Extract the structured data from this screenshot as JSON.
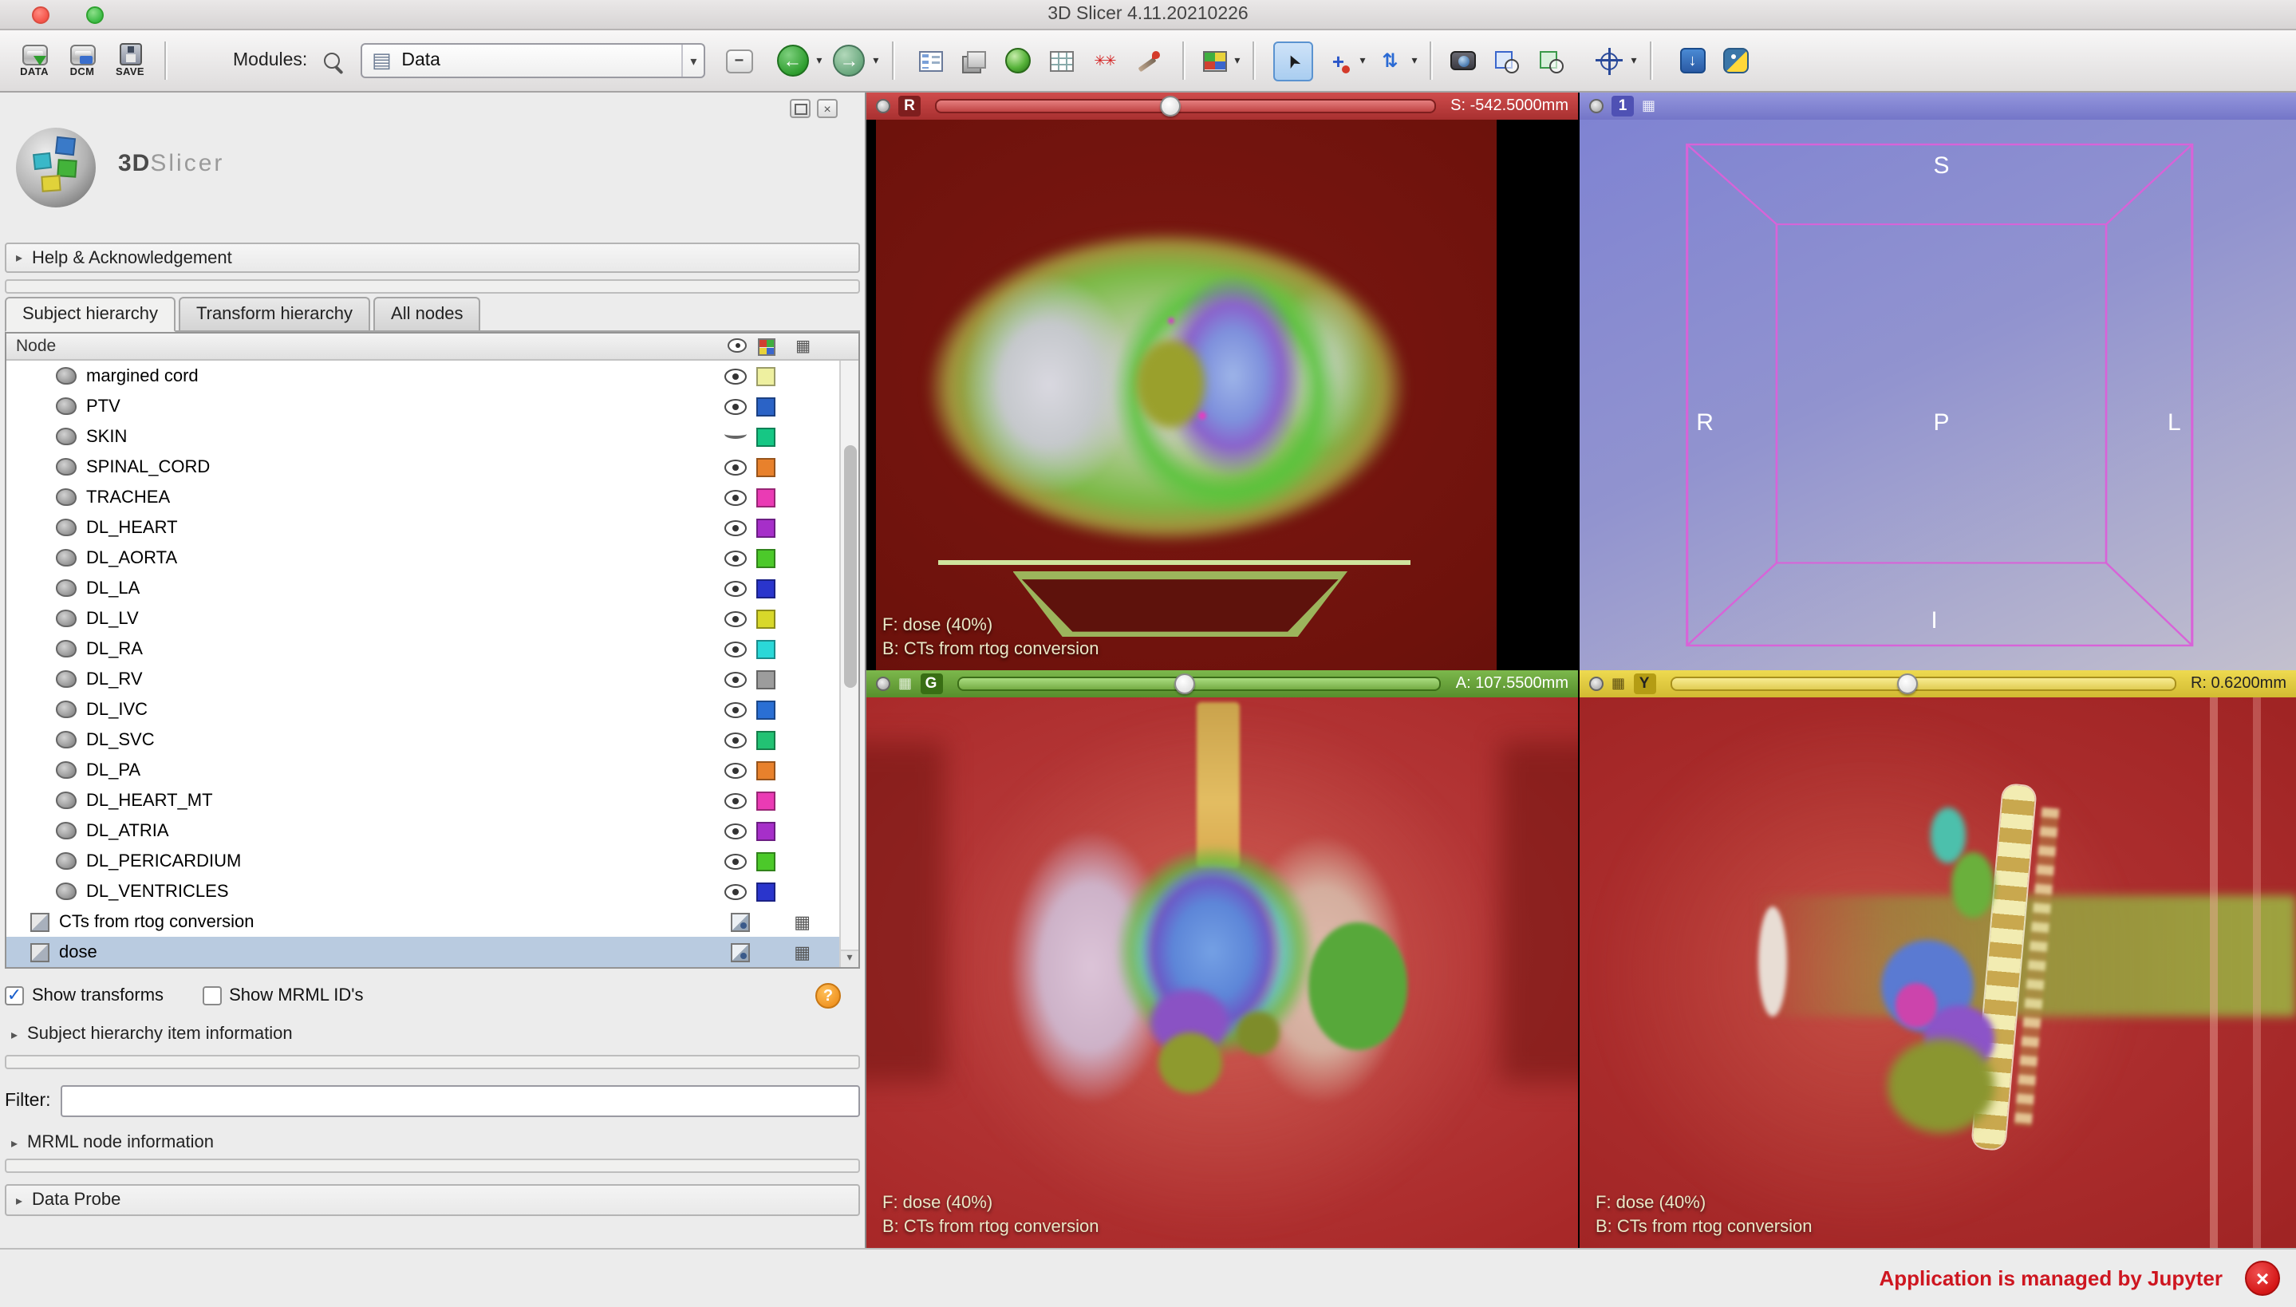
{
  "icons": {
    "chevron_down": "▾",
    "triangle_right": "▸",
    "grid": "▦",
    "check": "✓",
    "close_x": "×",
    "question": "?",
    "minus": "−",
    "back_arrow": "←",
    "forward_arrow": "→",
    "up_down_arrows": "⇅",
    "asterisks": "✳✳",
    "cursor": "➤",
    "module_tree": "▤",
    "down_arrow": "↓"
  },
  "window": {
    "title": "3D Slicer 4.11.20210226"
  },
  "toolbar": {
    "items": [
      {
        "kind": "big",
        "name": "load-data-button",
        "icon": "drive-data-icon",
        "label": "DATA"
      },
      {
        "kind": "big",
        "name": "load-dicom-button",
        "icon": "drive-dicom-icon",
        "label": "DCM"
      },
      {
        "kind": "big",
        "name": "save-scene-button",
        "icon": "floppy-icon",
        "label": "SAVE"
      },
      {
        "kind": "sep"
      },
      {
        "kind": "label",
        "name": "modules-label",
        "text": "Modules:"
      },
      {
        "kind": "icon",
        "name": "module-finder-button",
        "icon": "search-icon"
      },
      {
        "kind": "combo",
        "name": "module-selector-combo",
        "icon": "module-tree-icon",
        "glyph_key": "module_tree",
        "value": "Data"
      },
      {
        "kind": "mini",
        "name": "collapse-toolbar-button",
        "icon": "minus-icon",
        "glyph_key": "minus"
      },
      {
        "kind": "icon",
        "name": "module-history-back-button",
        "icon": "back-arrow-icon",
        "glyph_key": "back_arrow",
        "caret": true
      },
      {
        "kind": "icon",
        "name": "module-history-forward-button",
        "icon": "forward-arrow-icon",
        "glyph_key": "forward_arrow",
        "caret": true
      },
      {
        "kind": "sep"
      },
      {
        "kind": "icon",
        "name": "subject-hierarchy-module-button",
        "icon": "list-table-icon"
      },
      {
        "kind": "icon",
        "name": "volumes-module-button",
        "icon": "cube-icon"
      },
      {
        "kind": "icon",
        "name": "models-module-button",
        "icon": "green-sphere-icon"
      },
      {
        "kind": "icon",
        "name": "tables-module-button",
        "icon": "table-grid-icon"
      },
      {
        "kind": "icon",
        "name": "annotations-module-button",
        "icon": "red-asterisk-icon",
        "glyph_key": "asterisks"
      },
      {
        "kind": "icon",
        "name": "segment-editor-module-button",
        "icon": "paint-wand-icon"
      },
      {
        "kind": "sep"
      },
      {
        "kind": "icon",
        "name": "layout-selector-button",
        "icon": "layout-grid-icon",
        "caret": true
      },
      {
        "kind": "sep"
      },
      {
        "kind": "icon",
        "name": "mouse-interaction-button",
        "icon": "cursor-icon",
        "glyph_key": "cursor",
        "selected": true
      },
      {
        "kind": "icon",
        "name": "place-markup-button",
        "icon": "place-point-icon",
        "caret": true
      },
      {
        "kind": "icon",
        "name": "module-shortcuts-button",
        "icon": "blue-arrows-icon",
        "glyph_key": "up_down_arrows",
        "caret": true
      },
      {
        "kind": "sep"
      },
      {
        "kind": "icon",
        "name": "screenshot-button",
        "icon": "screenshot-icon"
      },
      {
        "kind": "icon",
        "name": "scene-view-save-button",
        "icon": "magnifier-box-icon"
      },
      {
        "kind": "icon",
        "name": "scene-view-restore-button",
        "icon": "magnifier-box2-icon"
      },
      {
        "kind": "icon",
        "name": "crosshair-button",
        "icon": "crosshair-icon",
        "caret": true
      },
      {
        "kind": "sep"
      },
      {
        "kind": "icon",
        "name": "extensions-manager-button",
        "icon": "extensions-icon",
        "glyph_key": "down_arrow"
      },
      {
        "kind": "icon",
        "name": "python-console-button",
        "icon": "python-icon"
      }
    ]
  },
  "panel": {
    "logo_bold": "3D",
    "logo_rest": "Slicer",
    "help_section_label": "Help & Acknowledgement",
    "tabs": [
      {
        "label": "Subject hierarchy",
        "active": true
      },
      {
        "label": "Transform hierarchy",
        "active": false
      },
      {
        "label": "All nodes",
        "active": false
      }
    ],
    "tree": {
      "header": "Node",
      "items": [
        {
          "name": "margined cord",
          "type": "segment",
          "color": "#eef0a0",
          "visible": true
        },
        {
          "name": "PTV",
          "type": "segment",
          "color": "#2b63c6",
          "visible": true
        },
        {
          "name": "SKIN",
          "type": "segment",
          "color": "#16c784",
          "visible": false
        },
        {
          "name": "SPINAL_CORD",
          "type": "segment",
          "color": "#e8812c",
          "visible": true
        },
        {
          "name": "TRACHEA",
          "type": "segment",
          "color": "#ea3bb4",
          "visible": true
        },
        {
          "name": "DL_HEART",
          "type": "segment",
          "color": "#a62fc9",
          "visible": true
        },
        {
          "name": "DL_AORTA",
          "type": "segment",
          "color": "#4cc92a",
          "visible": true
        },
        {
          "name": "DL_LA",
          "type": "segment",
          "color": "#2a35cc",
          "visible": true
        },
        {
          "name": "DL_LV",
          "type": "segment",
          "color": "#d8d82a",
          "visible": true
        },
        {
          "name": "DL_RA",
          "type": "segment",
          "color": "#2ad8d8",
          "visible": true
        },
        {
          "name": "DL_RV",
          "type": "segment",
          "color": "#9c9c9c",
          "visible": true
        },
        {
          "name": "DL_IVC",
          "type": "segment",
          "color": "#2a6fd4",
          "visible": true
        },
        {
          "name": "DL_SVC",
          "type": "segment",
          "color": "#22c273",
          "visible": true
        },
        {
          "name": "DL_PA",
          "type": "segment",
          "color": "#e8812c",
          "visible": true
        },
        {
          "name": "DL_HEART_MT",
          "type": "segment",
          "color": "#ea3bb4",
          "visible": true
        },
        {
          "name": "DL_ATRIA",
          "type": "segment",
          "color": "#a62fc9",
          "visible": true
        },
        {
          "name": "DL_PERICARDIUM",
          "type": "segment",
          "color": "#4cc92a",
          "visible": true
        },
        {
          "name": "DL_VENTRICLES",
          "type": "segment",
          "color": "#2a35cc",
          "visible": true
        },
        {
          "name": "CTs from rtog conversion",
          "type": "volume",
          "selected": false
        },
        {
          "name": "dose",
          "type": "volume",
          "selected": true
        }
      ]
    },
    "show_transforms_label": "Show transforms",
    "show_transforms_checked": true,
    "show_mrml_label": "Show MRML ID's",
    "show_mrml_checked": false,
    "item_info_label": "Subject hierarchy item information",
    "filter_label": "Filter:",
    "filter_value": "",
    "mrml_info_label": "MRML node information",
    "data_probe_label": "Data Probe"
  },
  "views": {
    "red": {
      "label": "R",
      "coord": "S: -542.5000mm",
      "slider_pos": 0.47,
      "fg": "F: dose (40%)",
      "bg": "B: CTs from rtog conversion",
      "color": "#cc4a4a"
    },
    "threeD": {
      "label": "1",
      "letters": [
        "S",
        "R",
        "P",
        "L",
        "I"
      ],
      "color": "#8a8cd8"
    },
    "green": {
      "label": "G",
      "coord": "A: 107.5500mm",
      "slider_pos": 0.47,
      "fg": "F: dose (40%)",
      "bg": "B: CTs from rtog conversion",
      "color": "#6aa83a"
    },
    "yellow": {
      "label": "Y",
      "coord": "R: 0.6200mm",
      "slider_pos": 0.47,
      "fg": "F: dose (40%)",
      "bg": "B: CTs from rtog conversion",
      "color": "#e8d44c"
    }
  },
  "status": {
    "message": "Application is managed by Jupyter"
  }
}
